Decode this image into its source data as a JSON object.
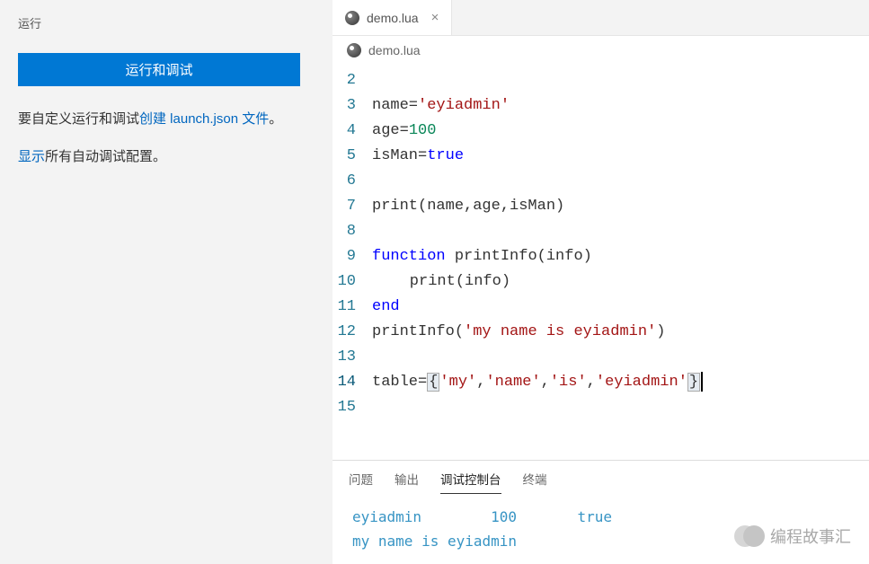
{
  "sidebar": {
    "title": "运行",
    "run_debug_button": "运行和调试",
    "custom_text_prefix": "要自定义运行和调试",
    "create_link": "创建 launch.json 文件",
    "period": "。",
    "show_link": "显示",
    "show_text_suffix": "所有自动调试配置。"
  },
  "tab": {
    "filename": "demo.lua"
  },
  "breadcrumb": {
    "filename": "demo.lua"
  },
  "code": {
    "lines": [
      {
        "n": 2,
        "segments": []
      },
      {
        "n": 3,
        "segments": [
          {
            "t": "plain",
            "v": "name="
          },
          {
            "t": "str",
            "v": "'eyiadmin'"
          }
        ]
      },
      {
        "n": 4,
        "segments": [
          {
            "t": "plain",
            "v": "age="
          },
          {
            "t": "num",
            "v": "100"
          }
        ]
      },
      {
        "n": 5,
        "segments": [
          {
            "t": "plain",
            "v": "isMan="
          },
          {
            "t": "kw",
            "v": "true"
          }
        ]
      },
      {
        "n": 6,
        "segments": []
      },
      {
        "n": 7,
        "segments": [
          {
            "t": "plain",
            "v": "print(name,age,isMan)"
          }
        ]
      },
      {
        "n": 8,
        "segments": []
      },
      {
        "n": 9,
        "segments": [
          {
            "t": "kw",
            "v": "function"
          },
          {
            "t": "plain",
            "v": " printInfo(info)"
          }
        ]
      },
      {
        "n": 10,
        "segments": [
          {
            "t": "guide",
            "v": ""
          },
          {
            "t": "plain",
            "v": "    print(info)"
          }
        ]
      },
      {
        "n": 11,
        "segments": [
          {
            "t": "kw",
            "v": "end"
          }
        ]
      },
      {
        "n": 12,
        "segments": [
          {
            "t": "plain",
            "v": "printInfo("
          },
          {
            "t": "str",
            "v": "'my name is eyiadmin'"
          },
          {
            "t": "plain",
            "v": ")"
          }
        ]
      },
      {
        "n": 13,
        "segments": []
      },
      {
        "n": 14,
        "active": true,
        "segments": [
          {
            "t": "plain",
            "v": "table="
          },
          {
            "t": "bracket",
            "v": "{"
          },
          {
            "t": "str",
            "v": "'my'"
          },
          {
            "t": "plain",
            "v": ","
          },
          {
            "t": "str",
            "v": "'name'"
          },
          {
            "t": "plain",
            "v": ","
          },
          {
            "t": "str",
            "v": "'is'"
          },
          {
            "t": "plain",
            "v": ","
          },
          {
            "t": "str",
            "v": "'eyiadmin'"
          },
          {
            "t": "bracket",
            "v": "}"
          },
          {
            "t": "cursor",
            "v": ""
          }
        ]
      },
      {
        "n": 15,
        "segments": []
      }
    ]
  },
  "panel": {
    "tabs": [
      "问题",
      "输出",
      "调试控制台",
      "终端"
    ],
    "active_tab": 2,
    "output_line1": "eyiadmin        100       true",
    "output_line2": "my name is eyiadmin"
  },
  "watermark": "编程故事汇"
}
